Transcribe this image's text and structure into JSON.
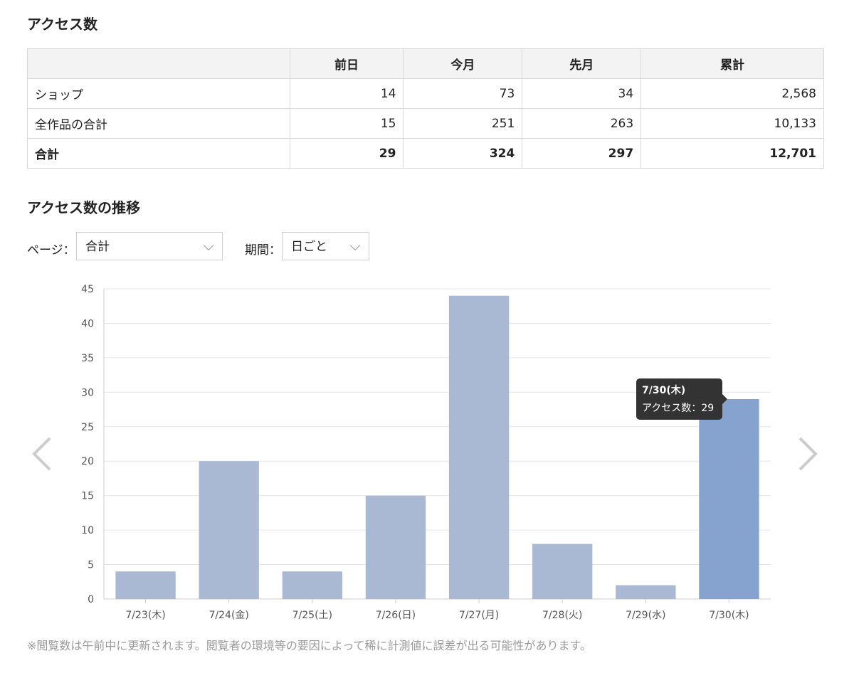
{
  "section1_title": "アクセス数",
  "table": {
    "columns": [
      "",
      "前日",
      "今月",
      "先月",
      "累計"
    ],
    "rows": [
      {
        "label": "ショップ",
        "values": [
          "14",
          "73",
          "34",
          "2,568"
        ]
      },
      {
        "label": "全作品の合計",
        "values": [
          "15",
          "251",
          "263",
          "10,133"
        ]
      },
      {
        "label": "合計",
        "values": [
          "29",
          "324",
          "297",
          "12,701"
        ]
      }
    ]
  },
  "section2_title": "アクセス数の推移",
  "filters": {
    "page_label": "ページ：",
    "page_value": "合計",
    "period_label": "期間：",
    "period_value": "日ごと"
  },
  "chart_data": {
    "type": "bar",
    "categories": [
      "7/23(木)",
      "7/24(金)",
      "7/25(土)",
      "7/26(日)",
      "7/27(月)",
      "7/28(火)",
      "7/29(水)",
      "7/30(木)"
    ],
    "values": [
      4,
      20,
      4,
      15,
      44,
      8,
      2,
      29
    ],
    "ylim": [
      0,
      45
    ],
    "yticks": [
      0,
      5,
      10,
      15,
      20,
      25,
      30,
      35,
      40,
      45
    ],
    "grid": true,
    "bar_color": "#aab9d3",
    "highlight_color": "#86a2cf",
    "highlighted_index": 7
  },
  "tooltip": {
    "title": "7/30(木)",
    "label": "アクセス数",
    "value": "29"
  },
  "nav": {
    "prev_icon": "chevron-left-icon",
    "next_icon": "chevron-right-icon"
  },
  "note": "※閲覧数は午前中に更新されます。閲覧者の環境等の要因によって稀に計測値に誤差が出る可能性があります。"
}
